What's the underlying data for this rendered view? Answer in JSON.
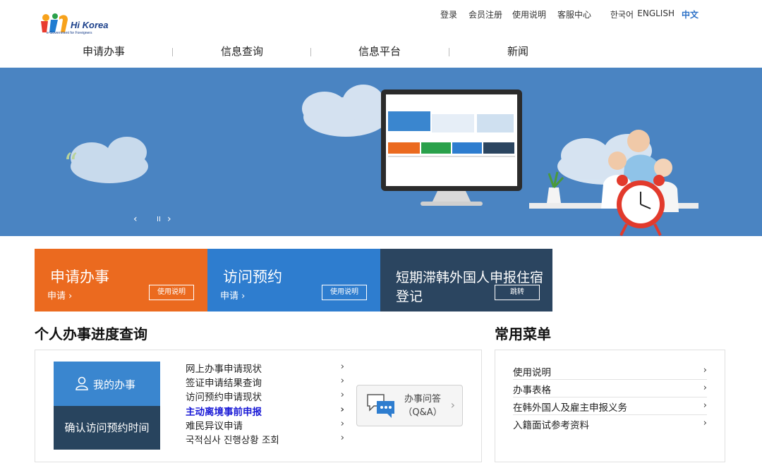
{
  "brand": {
    "name": "Hi Korea",
    "tagline": "e-Government for Foreigners"
  },
  "topnav": {
    "login": "登录",
    "register": "会员注册",
    "guide": "使用说明",
    "service": "客服中心",
    "lang_ko": "한국어",
    "lang_en": "ENGLISH",
    "lang_zh": "中文"
  },
  "mainnav": [
    "申请办事",
    "信息查询",
    "信息平台",
    "新闻"
  ],
  "banner": {
    "prev": "‹",
    "pause": "II",
    "next": "›",
    "colors": {
      "bg": "#4a84c2"
    }
  },
  "tiles": [
    {
      "title": "申请办事",
      "link": "申请",
      "button": "使用说明",
      "color": "#eb6a1f"
    },
    {
      "title": "访问预约",
      "link": "申请",
      "button": "使用说明",
      "color": "#2e7dcf"
    },
    {
      "title_line1": "短期滞韩外国人申报住宿",
      "title_line2": "登记",
      "button": "跳转",
      "color": "#2b4560"
    }
  ],
  "progress": {
    "title": "个人办事进度查询",
    "my_work": "我的办事",
    "confirm_visit": "确认访问预约时间",
    "items": [
      "网上办事申请现状",
      "签证申请结果查询",
      "访问预约申请现状",
      "主动离境事前申报",
      "难民异议申请",
      "국적심사 진행상황 조회"
    ],
    "highlighted_index": 3,
    "qa_line1": "办事问答",
    "qa_line2": "（Q&A）"
  },
  "menu": {
    "title": "常用菜单",
    "items": [
      "使用说明",
      "办事表格",
      "在韩外国人及雇主申报义务",
      "入籍面试参考资料"
    ]
  },
  "colors": {
    "accent_blue": "#2a6fc6",
    "orange": "#eb6a1f",
    "blue": "#2e7dcf",
    "navy": "#2b4560"
  }
}
